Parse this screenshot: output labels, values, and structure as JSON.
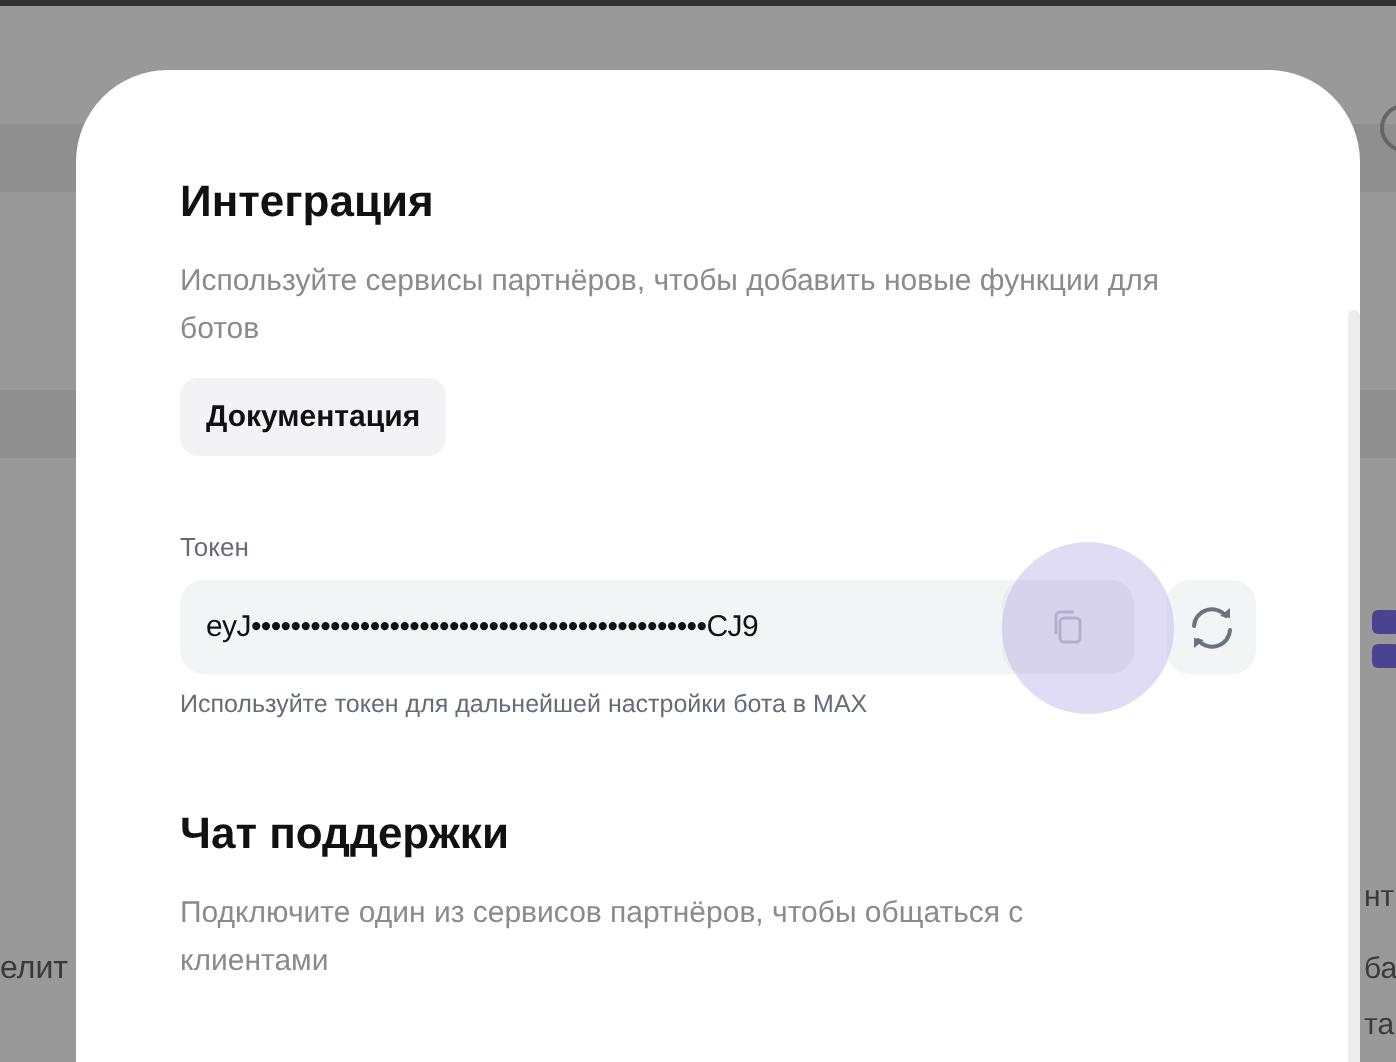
{
  "background": {
    "left_fragments": [
      "елит"
    ],
    "right_fragments": [
      "нт",
      "ба",
      "та"
    ]
  },
  "modal": {
    "title": "Интеграция",
    "description": "Используйте сервисы партнёров, чтобы добавить новые функции для ботов",
    "docs_button": "Документация",
    "token": {
      "label": "Токен",
      "value": "eyJ••••••••••••••••••••••••••••••••••••••••••••••CJ9",
      "copy_pressed": true,
      "hint": "Используйте токен для дальнейшей настройки бота в MAX"
    },
    "support": {
      "title": "Чат поддержки",
      "description": "Подключите один из сервисов партнёров, чтобы общаться с клиентами"
    }
  }
}
